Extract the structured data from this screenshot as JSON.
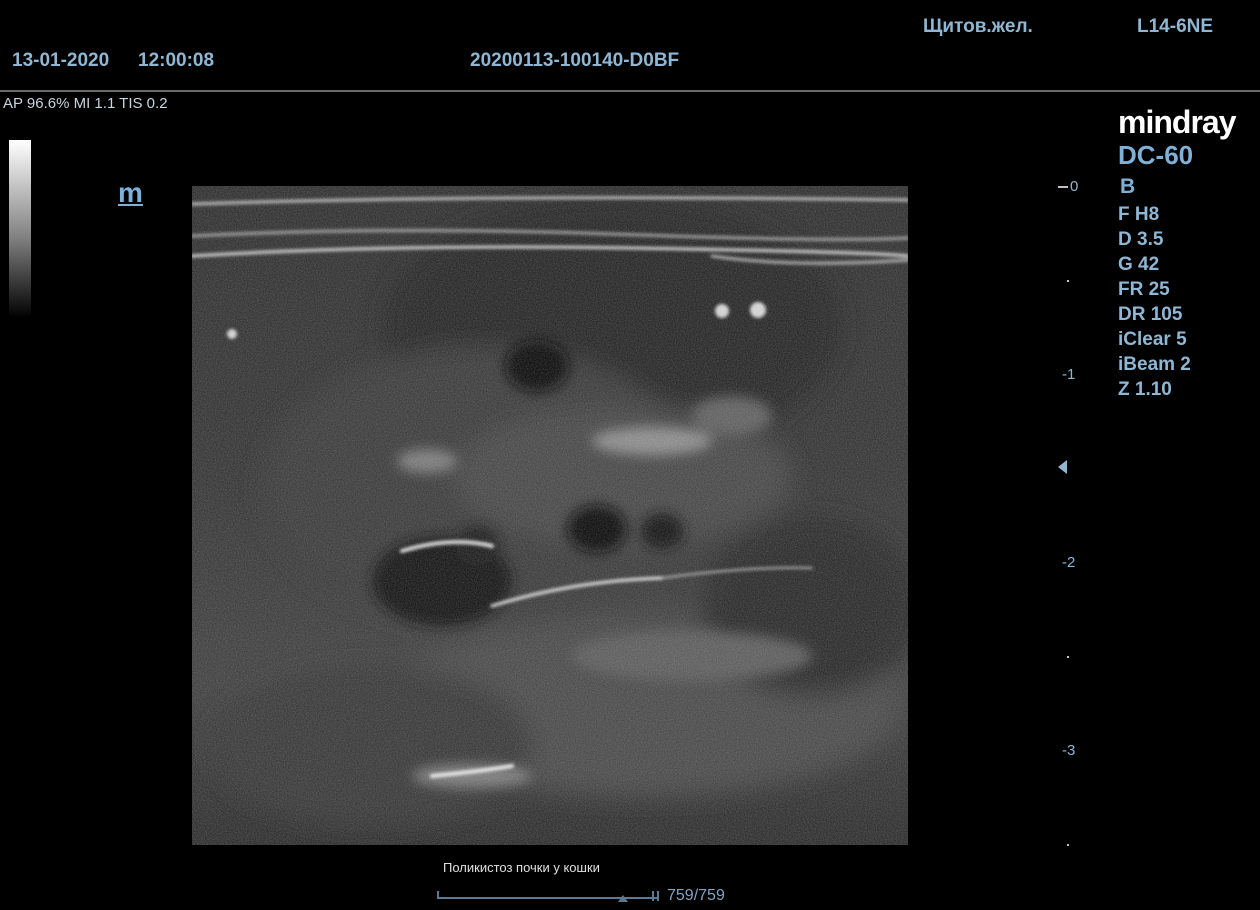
{
  "header": {
    "date": "13-01-2020",
    "time": "12:00:08",
    "patient_id": "20200113-100140-D0BF",
    "preset": "Щитов.жел.",
    "probe": "L14-6NE"
  },
  "acoustic": "AP 96.6%  MI 1.1 TIS 0.2",
  "orientation_mark": "m",
  "brand": "mindray",
  "model": "DC-60",
  "mode": "B",
  "params": [
    "F H8",
    "D 3.5",
    "G 42",
    "FR 25",
    "DR 105",
    "iClear 5",
    "iBeam 2",
    "Z 1.10"
  ],
  "depth_scale": {
    "labels": [
      "0",
      "1",
      "2",
      "3"
    ],
    "max_depth_cm": 3.5,
    "focus_depth_cm": 1.5
  },
  "caption": "Поликистоз почки у кошки",
  "cine": {
    "counter": "759/759",
    "position": 1.0
  },
  "colors": {
    "text": "#8fb7d3",
    "accent": "#7fb0d8",
    "brand": "#ffffff"
  },
  "icons": {
    "focus": "focus-marker-icon",
    "graybar": "grayscale-bar-icon"
  }
}
